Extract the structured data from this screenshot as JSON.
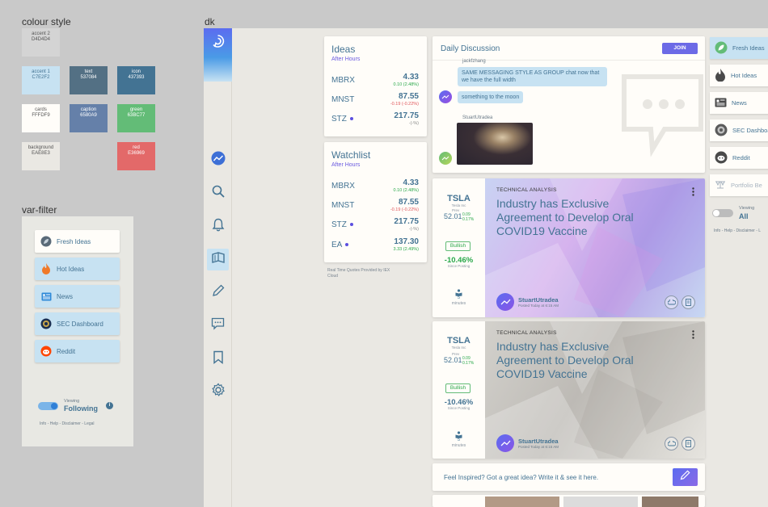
{
  "colour_style": {
    "title": "colour style",
    "swatches": [
      {
        "name": "accent 2",
        "hex": "D4D4D4",
        "color": "#D4D4D4",
        "text_color": "#555555"
      },
      {
        "name": "accent 1",
        "hex": "C7E2F2",
        "color": "#C7E2F2",
        "text_color": "#437393"
      },
      {
        "name": "text",
        "hex": "537084",
        "color": "#537084",
        "text_color": "#ffffff"
      },
      {
        "name": "icon",
        "hex": "437393",
        "color": "#437393",
        "text_color": "#ffffff"
      },
      {
        "name": "cards",
        "hex": "FFFDF9",
        "color": "#FFFDF9",
        "text_color": "#555555"
      },
      {
        "name": "caption",
        "hex": "6580A9",
        "color": "#6580A9",
        "text_color": "#ffffff"
      },
      {
        "name": "green",
        "hex": "63BC77",
        "color": "#63BC77",
        "text_color": "#ffffff"
      },
      {
        "name": "background",
        "hex": "EAE8E3",
        "color": "#EAE8E3",
        "text_color": "#555555"
      },
      {
        "name": "red",
        "hex": "E36969",
        "color": "#E36969",
        "text_color": "#ffffff"
      }
    ]
  },
  "var_filter": {
    "title": "var-filter",
    "items": [
      {
        "label": "Fresh Ideas",
        "icon": "leaf-icon",
        "active": true
      },
      {
        "label": "Hot Ideas",
        "icon": "flame-icon",
        "active": false
      },
      {
        "label": "News",
        "icon": "news-icon",
        "active": false
      },
      {
        "label": "SEC Dashboard",
        "icon": "sec-seal-icon",
        "active": false
      },
      {
        "label": "Reddit",
        "icon": "reddit-icon",
        "active": false
      }
    ],
    "viewing_label": "Viewing",
    "viewing_value": "Following",
    "footer": "Info - Help - Disclaimer - Legal"
  },
  "dk": {
    "title": "dk",
    "nav": [
      "logo-icon",
      "trending-icon",
      "search-icon",
      "bell-icon",
      "cards-icon",
      "pencil-icon",
      "chat-icon",
      "bookmark-icon",
      "gear-icon"
    ],
    "ideas": {
      "title": "Ideas",
      "subtitle": "After Hours",
      "rows": [
        {
          "symbol": "MBRX",
          "price": "4.33",
          "change": "0.10 (2.48%)",
          "dir": "up",
          "dot": false
        },
        {
          "symbol": "MNST",
          "price": "87.55",
          "change": "-0.19 (-0.22%)",
          "dir": "down",
          "dot": false
        },
        {
          "symbol": "STZ",
          "price": "217.75",
          "change": "-(-%)",
          "dir": "flat",
          "dot": true
        }
      ]
    },
    "watchlist": {
      "title": "Watchlist",
      "subtitle": "After Hours",
      "rows": [
        {
          "symbol": "MBRX",
          "price": "4.33",
          "change": "0.10 (2.48%)",
          "dir": "up",
          "dot": false
        },
        {
          "symbol": "MNST",
          "price": "87.55",
          "change": "-0.19 (-0.22%)",
          "dir": "down",
          "dot": false
        },
        {
          "symbol": "STZ",
          "price": "217.75",
          "change": "-(-%)",
          "dir": "flat",
          "dot": true
        },
        {
          "symbol": "EA",
          "price": "137.30",
          "change": "3.33 (2.49%)",
          "dir": "up",
          "dot": true
        }
      ]
    },
    "quotes_note": "Real Time Quotes Provided by IEX Cloud",
    "daily": {
      "title": "Daily Discussion",
      "join": "JOIN",
      "user1": "jackfzhang",
      "msg1": "SAME MESSAGING STYLE AS GROUP chat now that we have the full width",
      "msg2": "something to the moon",
      "user2": "StuartUtradea"
    },
    "posts": [
      {
        "ticker": "TSLA",
        "company": "Tesla Inc",
        "prev_label": "Prev",
        "price": "52.01",
        "chg1": "0.09",
        "chg2": "0.17%",
        "sentiment": "Bullish",
        "since": "-10.46%",
        "since_label": "Since Posting",
        "read_time": "5",
        "read_unit": "minutes",
        "kicker": "TECHNICAL ANALYSIS",
        "headline": "Industry has Exclusive Agreement to Develop Oral COVID19 Vaccine",
        "author": "StuartUtradea",
        "posted": "Posted Today at 6:15 AM"
      },
      {
        "ticker": "TSLA",
        "company": "Tesla Inc",
        "prev_label": "Prev",
        "price": "52.01",
        "chg1": "0.09",
        "chg2": "0.17%",
        "sentiment": "Bullish",
        "since": "-10.46%",
        "since_label": "Since Posting",
        "read_time": "5",
        "read_unit": "minutes",
        "kicker": "TECHNICAL ANALYSIS",
        "headline": "Industry has Exclusive Agreement to Develop Oral COVID19 Vaccine",
        "author": "StuartUtradea",
        "posted": "Posted Today at 6:15 AM"
      }
    ],
    "inspire": "Feel Inspired? Got a great idea? Write it & see it here.",
    "right_nav": [
      {
        "label": "Fresh Ideas",
        "icon": "leaf-icon",
        "active": true
      },
      {
        "label": "Hot Ideas",
        "icon": "flame-icon",
        "active": false
      },
      {
        "label": "News",
        "icon": "news-icon",
        "active": false
      },
      {
        "label": "SEC Dashboard",
        "icon": "sec-seal-icon",
        "active": false
      },
      {
        "label": "Reddit",
        "icon": "reddit-icon",
        "active": false
      },
      {
        "label": "Portfolio Be",
        "icon": "portfolio-icon",
        "active": false
      }
    ],
    "right_viewing_label": "Viewing",
    "right_viewing_value": "All",
    "right_footer": "Info - Help - Disclaimer - L"
  }
}
